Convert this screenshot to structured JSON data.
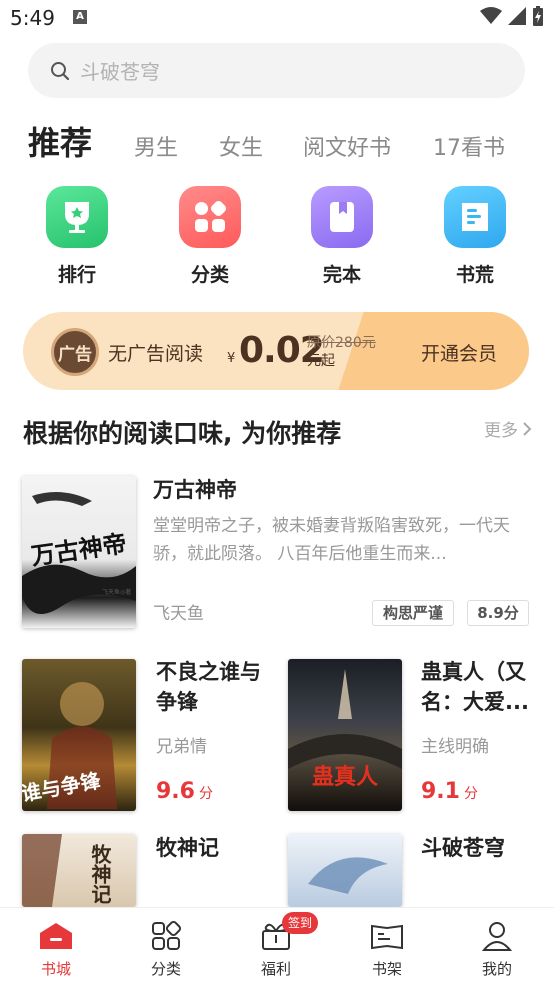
{
  "status_bar": {
    "time": "5:49"
  },
  "search": {
    "placeholder": "斗破苍穹"
  },
  "tabs": [
    {
      "label": "推荐",
      "active": true
    },
    {
      "label": "男生"
    },
    {
      "label": "女生"
    },
    {
      "label": "阅文好书"
    },
    {
      "label": "17看书"
    }
  ],
  "quick_entries": [
    {
      "label": "排行",
      "icon": "trophy-icon",
      "color": "#3fd27f"
    },
    {
      "label": "分类",
      "icon": "category-icon",
      "color": "#ff6b6b"
    },
    {
      "label": "完本",
      "icon": "book-icon",
      "color": "#9b7cf2"
    },
    {
      "label": "书荒",
      "icon": "booklist-icon",
      "color": "#39b6f3"
    }
  ],
  "vip_banner": {
    "badge_text": "广告",
    "title": "无广告阅读",
    "currency": "¥",
    "price": "0.02",
    "original_price": "原价280元",
    "suffix": "元起",
    "action": "开通会员"
  },
  "recommend": {
    "title": "根据你的阅读口味, 为你推荐",
    "more_label": "更多",
    "featured": {
      "title": "万古神帝",
      "description": "堂堂明帝之子，被未婚妻背叛陷害致死，一代天骄，就此陨落。 八百年后他重生而来...",
      "author": "飞天鱼",
      "tag": "构思严谨",
      "score": "8.9分",
      "cover_text": "万古神帝",
      "cover_author": "飞天鱼◎著"
    },
    "books": [
      {
        "title": "不良之谁与争锋",
        "tag": "兄弟情",
        "score": "9.6",
        "unit": "分",
        "cover_text": "谁与争锋"
      },
      {
        "title": "蛊真人（又名：大爱...",
        "tag": "主线明确",
        "score": "9.1",
        "unit": "分",
        "cover_text": "蛊真人"
      },
      {
        "title": "牧神记",
        "cover_text": "牧神记"
      },
      {
        "title": "斗破苍穹"
      }
    ]
  },
  "bottom_nav": [
    {
      "label": "书城",
      "icon": "bookstore-icon",
      "active": true
    },
    {
      "label": "分类",
      "icon": "category-icon"
    },
    {
      "label": "福利",
      "icon": "gift-icon",
      "badge": "签到"
    },
    {
      "label": "书架",
      "icon": "bookshelf-icon"
    },
    {
      "label": "我的",
      "icon": "profile-icon"
    }
  ],
  "colors": {
    "accent": "#e6383b",
    "vip_bg": "#fbe3c2",
    "vip_button": "#fbc98a"
  }
}
